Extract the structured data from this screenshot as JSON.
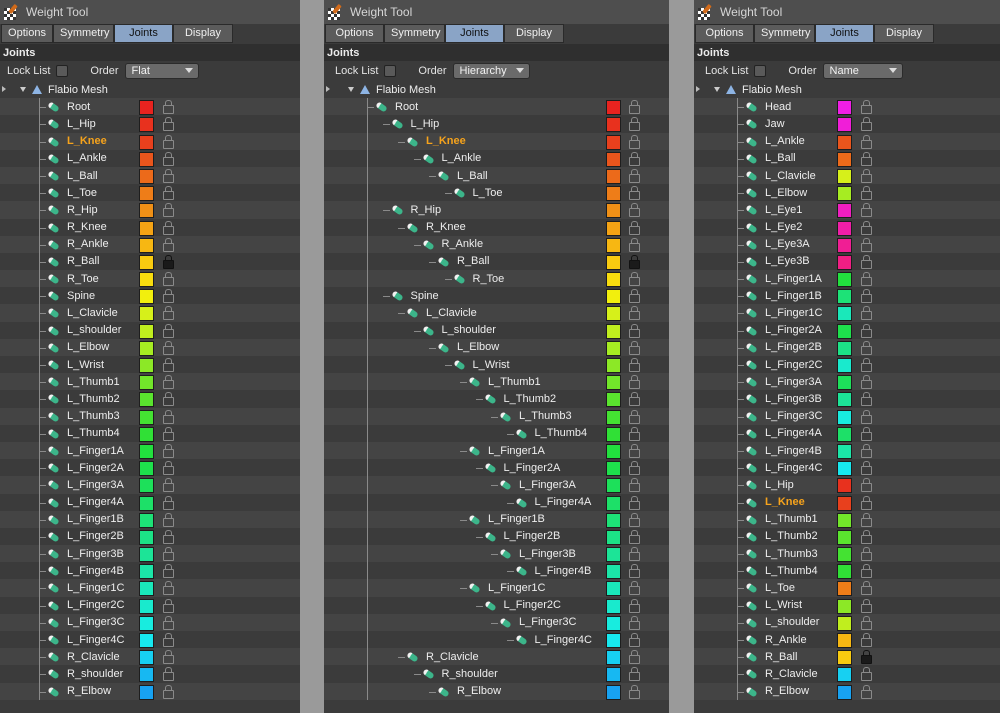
{
  "panels": [
    {
      "title": "Weight Tool",
      "tabs": [
        "Options",
        "Symmetry",
        "Joints",
        "Display"
      ],
      "active_tab": "Joints",
      "section": "Joints",
      "lock_list_label": "Lock List",
      "order_label": "Order",
      "order_value": "Flat",
      "mesh_name": "Flabio Mesh",
      "joints": [
        {
          "name": "Root",
          "depth": 0,
          "color": "#e8231f",
          "locked": false
        },
        {
          "name": "L_Hip",
          "depth": 0,
          "color": "#e8311e",
          "locked": false
        },
        {
          "name": "L_Knee",
          "depth": 0,
          "color": "#e8401d",
          "locked": false,
          "selected": true
        },
        {
          "name": "L_Ankle",
          "depth": 0,
          "color": "#ea551c",
          "locked": false
        },
        {
          "name": "L_Ball",
          "depth": 0,
          "color": "#ec6a1a",
          "locked": false
        },
        {
          "name": "L_Toe",
          "depth": 0,
          "color": "#ee7d18",
          "locked": false
        },
        {
          "name": "R_Hip",
          "depth": 0,
          "color": "#f09016",
          "locked": false
        },
        {
          "name": "R_Knee",
          "depth": 0,
          "color": "#f4a314",
          "locked": false
        },
        {
          "name": "R_Ankle",
          "depth": 0,
          "color": "#f7b712",
          "locked": false
        },
        {
          "name": "R_Ball",
          "depth": 0,
          "color": "#f9cb10",
          "locked": true
        },
        {
          "name": "R_Toe",
          "depth": 0,
          "color": "#f8dc0e",
          "locked": false
        },
        {
          "name": "Spine",
          "depth": 0,
          "color": "#f2ef0d",
          "locked": false
        },
        {
          "name": "L_Clavicle",
          "depth": 0,
          "color": "#d6f01a",
          "locked": false
        },
        {
          "name": "L_shoulder",
          "depth": 0,
          "color": "#c0ee1e",
          "locked": false
        },
        {
          "name": "L_Elbow",
          "depth": 0,
          "color": "#a6ec22",
          "locked": false
        },
        {
          "name": "L_Wrist",
          "depth": 0,
          "color": "#8ce826",
          "locked": false
        },
        {
          "name": "L_Thumb1",
          "depth": 0,
          "color": "#72e62a",
          "locked": false
        },
        {
          "name": "L_Thumb2",
          "depth": 0,
          "color": "#5ae42e",
          "locked": false
        },
        {
          "name": "L_Thumb3",
          "depth": 0,
          "color": "#44e232",
          "locked": false
        },
        {
          "name": "L_Thumb4",
          "depth": 0,
          "color": "#30e036",
          "locked": false
        },
        {
          "name": "L_Finger1A",
          "depth": 0,
          "color": "#22e03e",
          "locked": false
        },
        {
          "name": "L_Finger2A",
          "depth": 0,
          "color": "#1ee04c",
          "locked": false
        },
        {
          "name": "L_Finger3A",
          "depth": 0,
          "color": "#1de05a",
          "locked": false
        },
        {
          "name": "L_Finger4A",
          "depth": 0,
          "color": "#1de068",
          "locked": false
        },
        {
          "name": "L_Finger1B",
          "depth": 0,
          "color": "#1de277",
          "locked": false
        },
        {
          "name": "L_Finger2B",
          "depth": 0,
          "color": "#1ce286",
          "locked": false
        },
        {
          "name": "L_Finger3B",
          "depth": 0,
          "color": "#1ce497",
          "locked": false
        },
        {
          "name": "L_Finger4B",
          "depth": 0,
          "color": "#1be6a8",
          "locked": false
        },
        {
          "name": "L_Finger1C",
          "depth": 0,
          "color": "#1ae8ba",
          "locked": false
        },
        {
          "name": "L_Finger2C",
          "depth": 0,
          "color": "#19eacd",
          "locked": false
        },
        {
          "name": "L_Finger3C",
          "depth": 0,
          "color": "#18ecdf",
          "locked": false
        },
        {
          "name": "L_Finger4C",
          "depth": 0,
          "color": "#17e8ef",
          "locked": false
        },
        {
          "name": "R_Clavicle",
          "depth": 0,
          "color": "#17d0f2",
          "locked": false
        },
        {
          "name": "R_shoulder",
          "depth": 0,
          "color": "#17b8f2",
          "locked": false
        },
        {
          "name": "R_Elbow",
          "depth": 0,
          "color": "#17a2f2",
          "locked": false
        }
      ]
    },
    {
      "title": "Weight Tool",
      "tabs": [
        "Options",
        "Symmetry",
        "Joints",
        "Display"
      ],
      "active_tab": "Joints",
      "section": "Joints",
      "lock_list_label": "Lock List",
      "order_label": "Order",
      "order_value": "Hierarchy",
      "mesh_name": "Flabio Mesh",
      "joints": [
        {
          "name": "Root",
          "depth": 0,
          "color": "#e8231f",
          "locked": false
        },
        {
          "name": "L_Hip",
          "depth": 1,
          "color": "#e8311e",
          "locked": false
        },
        {
          "name": "L_Knee",
          "depth": 2,
          "color": "#e8401d",
          "locked": false,
          "selected": true
        },
        {
          "name": "L_Ankle",
          "depth": 3,
          "color": "#ea551c",
          "locked": false
        },
        {
          "name": "L_Ball",
          "depth": 4,
          "color": "#ec6a1a",
          "locked": false
        },
        {
          "name": "L_Toe",
          "depth": 5,
          "color": "#ee7d18",
          "locked": false
        },
        {
          "name": "R_Hip",
          "depth": 1,
          "color": "#f09016",
          "locked": false
        },
        {
          "name": "R_Knee",
          "depth": 2,
          "color": "#f4a314",
          "locked": false
        },
        {
          "name": "R_Ankle",
          "depth": 3,
          "color": "#f7b712",
          "locked": false
        },
        {
          "name": "R_Ball",
          "depth": 4,
          "color": "#f9cb10",
          "locked": true
        },
        {
          "name": "R_Toe",
          "depth": 5,
          "color": "#f8dc0e",
          "locked": false
        },
        {
          "name": "Spine",
          "depth": 1,
          "color": "#f2ef0d",
          "locked": false
        },
        {
          "name": "L_Clavicle",
          "depth": 2,
          "color": "#d6f01a",
          "locked": false
        },
        {
          "name": "L_shoulder",
          "depth": 3,
          "color": "#c0ee1e",
          "locked": false
        },
        {
          "name": "L_Elbow",
          "depth": 4,
          "color": "#a6ec22",
          "locked": false
        },
        {
          "name": "L_Wrist",
          "depth": 5,
          "color": "#8ce826",
          "locked": false
        },
        {
          "name": "L_Thumb1",
          "depth": 6,
          "color": "#72e62a",
          "locked": false
        },
        {
          "name": "L_Thumb2",
          "depth": 7,
          "color": "#5ae42e",
          "locked": false
        },
        {
          "name": "L_Thumb3",
          "depth": 8,
          "color": "#44e232",
          "locked": false
        },
        {
          "name": "L_Thumb4",
          "depth": 9,
          "color": "#30e036",
          "locked": false
        },
        {
          "name": "L_Finger1A",
          "depth": 6,
          "color": "#22e03e",
          "locked": false
        },
        {
          "name": "L_Finger2A",
          "depth": 7,
          "color": "#1ee04c",
          "locked": false
        },
        {
          "name": "L_Finger3A",
          "depth": 8,
          "color": "#1de05a",
          "locked": false
        },
        {
          "name": "L_Finger4A",
          "depth": 9,
          "color": "#1de068",
          "locked": false
        },
        {
          "name": "L_Finger1B",
          "depth": 6,
          "color": "#1de277",
          "locked": false
        },
        {
          "name": "L_Finger2B",
          "depth": 7,
          "color": "#1ce286",
          "locked": false
        },
        {
          "name": "L_Finger3B",
          "depth": 8,
          "color": "#1ce497",
          "locked": false
        },
        {
          "name": "L_Finger4B",
          "depth": 9,
          "color": "#1be6a8",
          "locked": false
        },
        {
          "name": "L_Finger1C",
          "depth": 6,
          "color": "#1ae8ba",
          "locked": false
        },
        {
          "name": "L_Finger2C",
          "depth": 7,
          "color": "#19eacd",
          "locked": false
        },
        {
          "name": "L_Finger3C",
          "depth": 8,
          "color": "#18ecdf",
          "locked": false
        },
        {
          "name": "L_Finger4C",
          "depth": 9,
          "color": "#17e8ef",
          "locked": false
        },
        {
          "name": "R_Clavicle",
          "depth": 2,
          "color": "#17d0f2",
          "locked": false
        },
        {
          "name": "R_shoulder",
          "depth": 3,
          "color": "#17b8f2",
          "locked": false
        },
        {
          "name": "R_Elbow",
          "depth": 4,
          "color": "#17a2f2",
          "locked": false
        }
      ]
    },
    {
      "title": "Weight Tool",
      "tabs": [
        "Options",
        "Symmetry",
        "Joints",
        "Display"
      ],
      "active_tab": "Joints",
      "section": "Joints",
      "lock_list_label": "Lock List",
      "order_label": "Order",
      "order_value": "Name",
      "mesh_name": "Flabio Mesh",
      "joints": [
        {
          "name": "Head",
          "depth": 0,
          "color": "#f01ee6",
          "locked": false
        },
        {
          "name": "Jaw",
          "depth": 0,
          "color": "#f01ed8",
          "locked": false
        },
        {
          "name": "L_Ankle",
          "depth": 0,
          "color": "#ea551c",
          "locked": false
        },
        {
          "name": "L_Ball",
          "depth": 0,
          "color": "#ec6a1a",
          "locked": false
        },
        {
          "name": "L_Clavicle",
          "depth": 0,
          "color": "#d6f01a",
          "locked": false
        },
        {
          "name": "L_Elbow",
          "depth": 0,
          "color": "#a6ec22",
          "locked": false
        },
        {
          "name": "L_Eye1",
          "depth": 0,
          "color": "#f01ec0",
          "locked": false
        },
        {
          "name": "L_Eye2",
          "depth": 0,
          "color": "#f01ea8",
          "locked": false
        },
        {
          "name": "L_Eye3A",
          "depth": 0,
          "color": "#f01e94",
          "locked": false
        },
        {
          "name": "L_Eye3B",
          "depth": 0,
          "color": "#f01e84",
          "locked": false
        },
        {
          "name": "L_Finger1A",
          "depth": 0,
          "color": "#22e03e",
          "locked": false
        },
        {
          "name": "L_Finger1B",
          "depth": 0,
          "color": "#1de277",
          "locked": false
        },
        {
          "name": "L_Finger1C",
          "depth": 0,
          "color": "#1ae8ba",
          "locked": false
        },
        {
          "name": "L_Finger2A",
          "depth": 0,
          "color": "#1ee04c",
          "locked": false
        },
        {
          "name": "L_Finger2B",
          "depth": 0,
          "color": "#1ce286",
          "locked": false
        },
        {
          "name": "L_Finger2C",
          "depth": 0,
          "color": "#19eacd",
          "locked": false
        },
        {
          "name": "L_Finger3A",
          "depth": 0,
          "color": "#1de05a",
          "locked": false
        },
        {
          "name": "L_Finger3B",
          "depth": 0,
          "color": "#1ce497",
          "locked": false
        },
        {
          "name": "L_Finger3C",
          "depth": 0,
          "color": "#18ecdf",
          "locked": false
        },
        {
          "name": "L_Finger4A",
          "depth": 0,
          "color": "#1de068",
          "locked": false
        },
        {
          "name": "L_Finger4B",
          "depth": 0,
          "color": "#1be6a8",
          "locked": false
        },
        {
          "name": "L_Finger4C",
          "depth": 0,
          "color": "#17e8ef",
          "locked": false
        },
        {
          "name": "L_Hip",
          "depth": 0,
          "color": "#e8311e",
          "locked": false
        },
        {
          "name": "L_Knee",
          "depth": 0,
          "color": "#e8401d",
          "locked": false,
          "selected": true
        },
        {
          "name": "L_Thumb1",
          "depth": 0,
          "color": "#72e62a",
          "locked": false
        },
        {
          "name": "L_Thumb2",
          "depth": 0,
          "color": "#5ae42e",
          "locked": false
        },
        {
          "name": "L_Thumb3",
          "depth": 0,
          "color": "#44e232",
          "locked": false
        },
        {
          "name": "L_Thumb4",
          "depth": 0,
          "color": "#30e036",
          "locked": false
        },
        {
          "name": "L_Toe",
          "depth": 0,
          "color": "#ee7d18",
          "locked": false
        },
        {
          "name": "L_Wrist",
          "depth": 0,
          "color": "#8ce826",
          "locked": false
        },
        {
          "name": "L_shoulder",
          "depth": 0,
          "color": "#c0ee1e",
          "locked": false
        },
        {
          "name": "R_Ankle",
          "depth": 0,
          "color": "#f7b712",
          "locked": false
        },
        {
          "name": "R_Ball",
          "depth": 0,
          "color": "#f9cb10",
          "locked": true
        },
        {
          "name": "R_Clavicle",
          "depth": 0,
          "color": "#17d0f2",
          "locked": false
        },
        {
          "name": "R_Elbow",
          "depth": 0,
          "color": "#17a2f2",
          "locked": false
        }
      ]
    }
  ]
}
